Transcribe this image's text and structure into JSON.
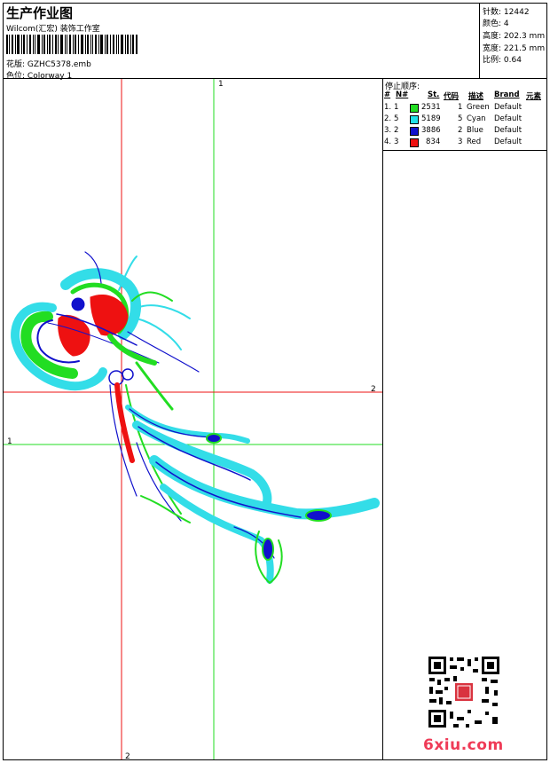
{
  "header": {
    "title": "生产作业图",
    "company": "Wilcom(汇宏) 装饰工作室",
    "file_label": "花版:",
    "file_name": "GZHC5378.emb",
    "colorway_label": "色位:",
    "colorway": "Colorway 1"
  },
  "meta": [
    {
      "label": "针数:",
      "value": "12442"
    },
    {
      "label": "颜色:",
      "value": "4"
    },
    {
      "label": "高度:",
      "value": "202.3 mm"
    },
    {
      "label": "宽度:",
      "value": "221.5 mm"
    },
    {
      "label": "比例:",
      "value": "0.64"
    }
  ],
  "stop_sequence": {
    "title": "停止顺序:",
    "columns": [
      "#",
      "N#",
      "St.",
      "代码",
      "描述",
      "Brand",
      "元素"
    ],
    "rows": [
      {
        "idx": "1.",
        "n": "1",
        "st": "2531",
        "code": "1",
        "desc": "Green",
        "brand": "Default",
        "color": "#22dd22"
      },
      {
        "idx": "2.",
        "n": "5",
        "st": "5189",
        "code": "5",
        "desc": "Cyan",
        "brand": "Default",
        "color": "#22e0e8"
      },
      {
        "idx": "3.",
        "n": "2",
        "st": "3886",
        "code": "2",
        "desc": "Blue",
        "brand": "Default",
        "color": "#1111cc"
      },
      {
        "idx": "4.",
        "n": "3",
        "st": "834",
        "code": "3",
        "desc": "Red",
        "brand": "Default",
        "color": "#ee1111"
      }
    ]
  },
  "guides": {
    "green_v_label": "1",
    "green_h_label": "1",
    "red_h_label": "2",
    "red_v_label": "2"
  },
  "colors": {
    "green": "#22dd22",
    "cyan": "#33dde8",
    "blue": "#1111cc",
    "red": "#ee1111"
  },
  "watermark": "6xiu.com"
}
